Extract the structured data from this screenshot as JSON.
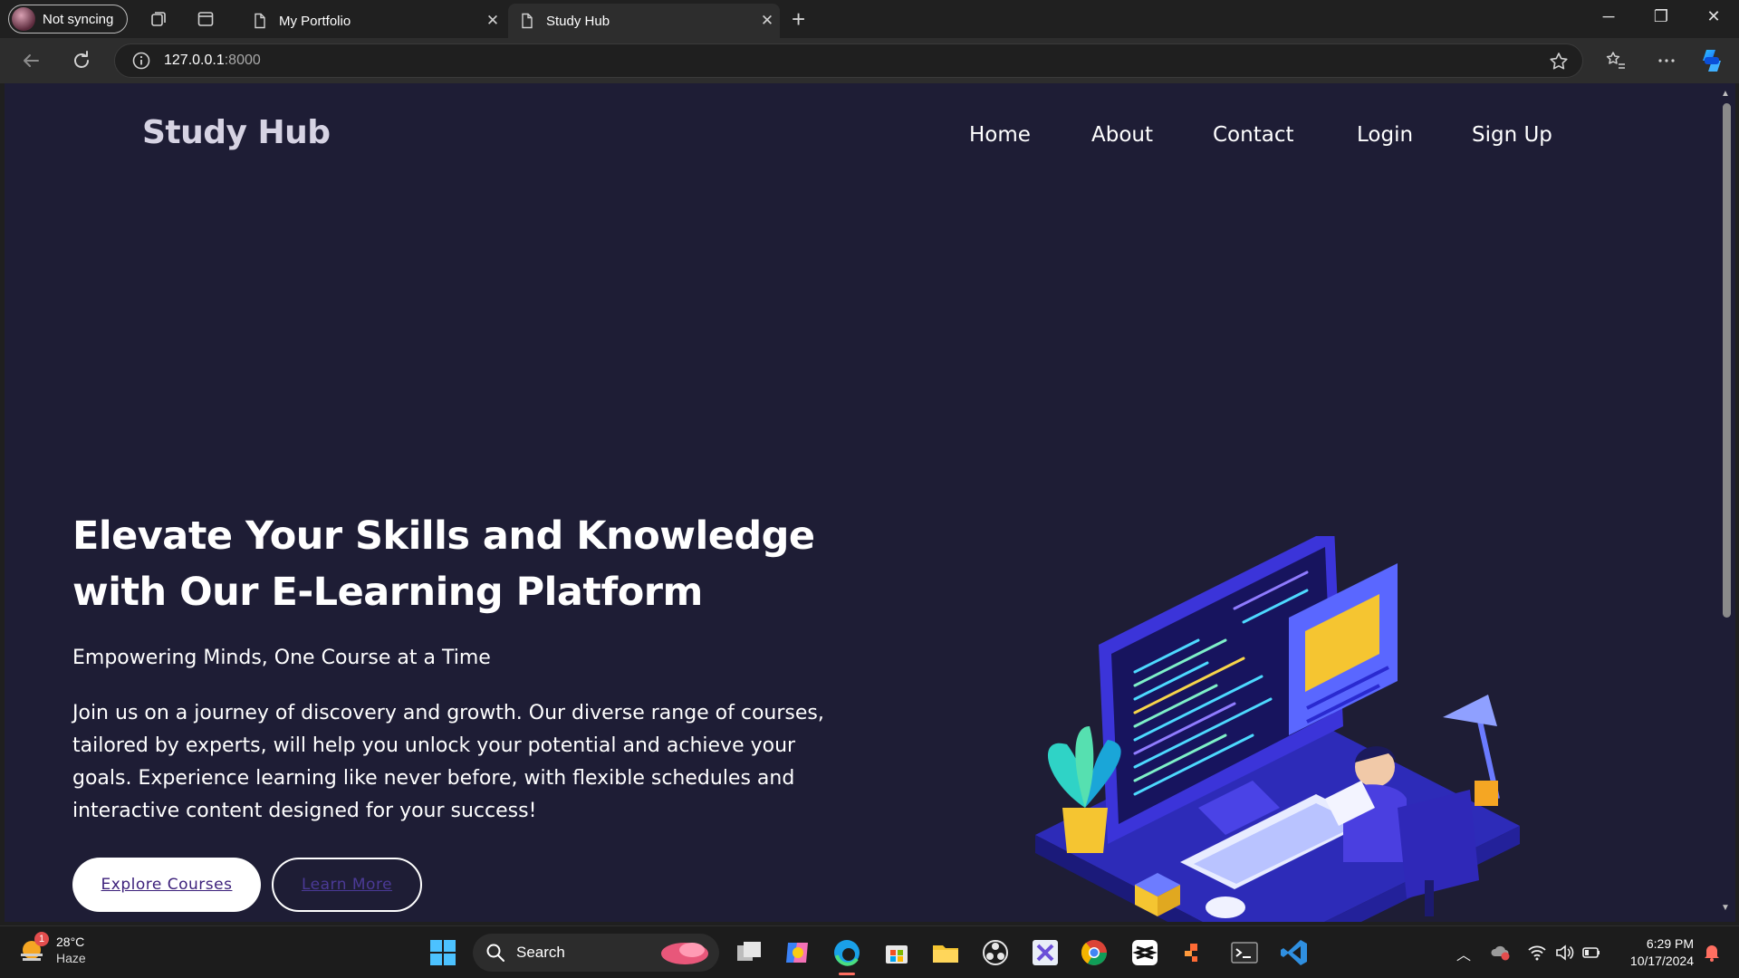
{
  "browser": {
    "profile_label": "Not syncing",
    "tabs": [
      {
        "title": "My Portfolio",
        "active": false
      },
      {
        "title": "Study Hub",
        "active": true
      }
    ],
    "url_host": "127.0.0.1",
    "url_port": ":8000"
  },
  "page": {
    "brand": "Study Hub",
    "nav": [
      "Home",
      "About",
      "Contact",
      "Login",
      "Sign Up"
    ],
    "hero_title": "Elevate Your Skills and Knowledge with Our E-Learning Platform",
    "hero_subtitle": "Empowering Minds, One Course at a Time",
    "hero_body": "Join us on a journey of discovery and growth. Our diverse range of courses, tailored by experts, will help you unlock your potential and achieve your goals. Experience learning like never before, with flexible schedules and interactive content designed for your success!",
    "primary_button": "Explore Courses",
    "secondary_button": "Learn More"
  },
  "taskbar": {
    "weather_temp": "28°C",
    "weather_cond": "Haze",
    "weather_badge": "1",
    "search_label": "Search",
    "time": "6:29 PM",
    "date": "10/17/2024"
  },
  "colors": {
    "page_bg": "#1e1d35",
    "accent": "#3b1f7a"
  }
}
